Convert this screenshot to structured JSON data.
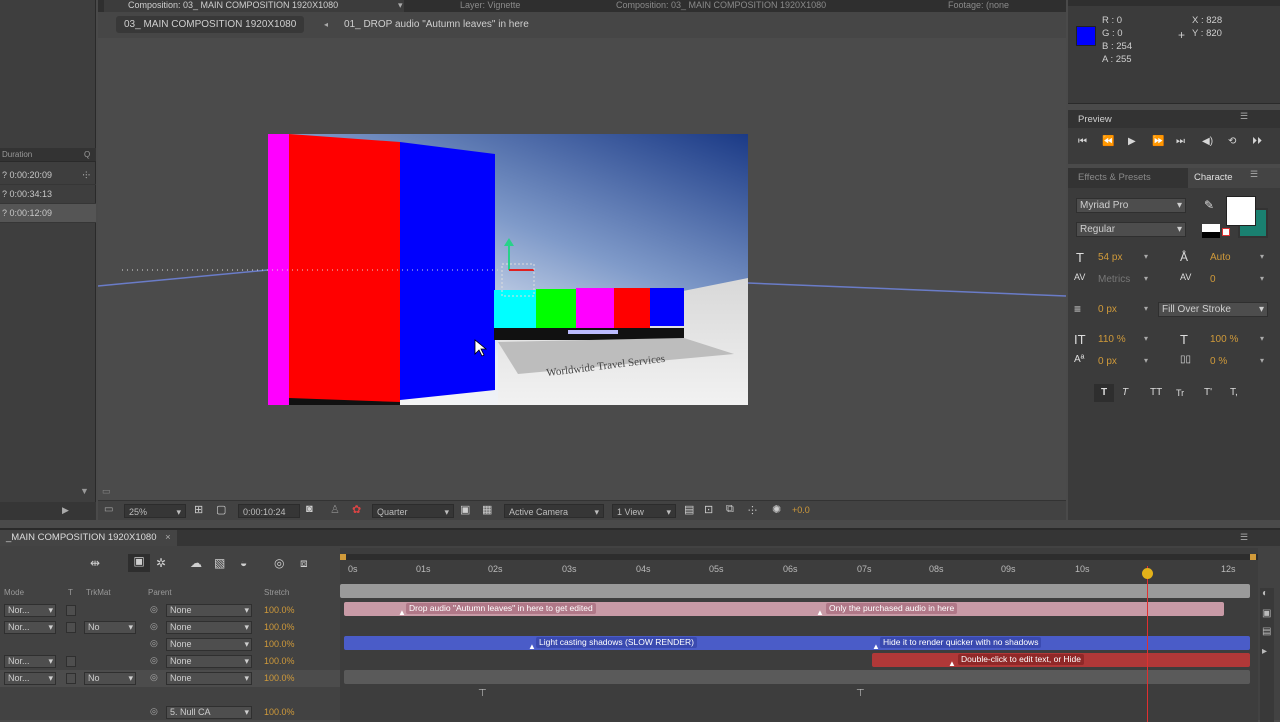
{
  "left_panel": {
    "duration_header": "Duration",
    "q_header": "Q",
    "rows": [
      "? 0:00:20:09",
      "? 0:00:34:13",
      "? 0:00:12:09"
    ]
  },
  "comp_tabs": {
    "composition": "Composition: 03_ MAIN COMPOSITION 1920X1080",
    "layer": "Layer: Vignette",
    "composition2": "Composition: 03_ MAIN COMPOSITION 1920X1080",
    "footage": "Footage: (none"
  },
  "breadcrumbs": [
    "03_ MAIN COMPOSITION 1920X1080",
    "01_ DROP audio \"Autumn leaves\" in here"
  ],
  "viewer": {
    "caption": "Worldwide Travel Services"
  },
  "viewer_toolbar": {
    "zoom": "25%",
    "timecode": "0:00:10:24",
    "resolution": "Quarter",
    "camera": "Active Camera",
    "views": "1 View",
    "exposure": "+0.0"
  },
  "info": {
    "r": "R : 0",
    "g": "G : 0",
    "b": "B : 254",
    "a": "A : 255",
    "x": "X : 828",
    "y": "Y : 820",
    "swatch_color": "#0000fe"
  },
  "preview": {
    "title": "Preview"
  },
  "character": {
    "tab_effects": "Effects & Presets",
    "tab_character": "Characte",
    "font": "Myriad Pro",
    "style": "Regular",
    "size": "54 px",
    "leading": "Auto",
    "kerning": "Metrics",
    "tracking": "0",
    "stroke": "0 px",
    "stroke_mode": "Fill Over Stroke",
    "vscale": "110 %",
    "hscale": "100 %",
    "baseline": "0 px",
    "tsume": "0 %",
    "styles": [
      "T",
      "T",
      "TT",
      "Tr",
      "T'",
      "T,"
    ]
  },
  "timeline": {
    "comp_name": "_MAIN COMPOSITION 1920X1080",
    "col_mode": "Mode",
    "col_t": "T",
    "col_trkmat": "TrkMat",
    "col_parent": "Parent",
    "col_stretch": "Stretch",
    "ruler": [
      "0s",
      "01s",
      "02s",
      "03s",
      "04s",
      "05s",
      "06s",
      "07s",
      "08s",
      "09s",
      "10s",
      "12s"
    ],
    "rows": [
      {
        "mode": "Nor...",
        "trk": "",
        "parent": "None",
        "stretch": "100.0%"
      },
      {
        "mode": "Nor...",
        "trk": "No",
        "parent": "None",
        "stretch": "100.0%"
      },
      {
        "mode": "",
        "trk": "",
        "parent": "None",
        "stretch": "100.0%"
      },
      {
        "mode": "Nor...",
        "trk": "",
        "parent": "None",
        "stretch": "100.0%"
      },
      {
        "mode": "Nor...",
        "trk": "No",
        "parent": "None",
        "stretch": "100.0%"
      },
      {
        "mode": "",
        "trk": "",
        "parent": "5. Null CA",
        "stretch": "100.0%"
      }
    ],
    "markers": {
      "m1": "Drop audio \"Autumn leaves\" in here to get edited",
      "m2": "Only the purchased audio in here",
      "m3": "Light casting shadows (SLOW RENDER)",
      "m4": "Hide it to render quicker with no shadows",
      "m5": "Double-click to edit text, or Hide"
    }
  }
}
